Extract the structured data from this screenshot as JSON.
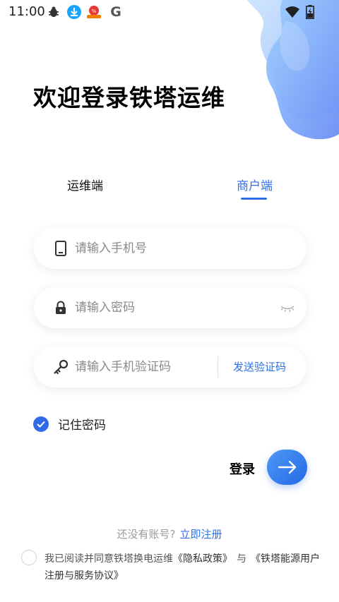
{
  "status_bar": {
    "time": "11:00",
    "icons": [
      "bug-icon",
      "download-icon",
      "notification-app-icon",
      "google-icon",
      "wifi-icon",
      "battery-charging-icon"
    ],
    "google_letter": "G"
  },
  "page_title": "欢迎登录铁塔运维",
  "tabs": [
    {
      "label": "运维端",
      "active": false
    },
    {
      "label": "商户端",
      "active": true
    }
  ],
  "form": {
    "phone_placeholder": "请输入手机号",
    "password_placeholder": "请输入密码",
    "code_placeholder": "请输入手机验证码",
    "send_code_label": "发送验证码"
  },
  "remember": {
    "label": "记住密码",
    "checked": true
  },
  "login": {
    "label": "登录"
  },
  "register": {
    "question": "还没有账号?",
    "link": "立即注册"
  },
  "agreement": {
    "prefix": "我已阅读并同意铁塔换电运维",
    "privacy_link": "《隐私政策》",
    "conjunction": "与",
    "terms_link": "《铁塔能源用户注册与服务协议》",
    "checked": false
  },
  "colors": {
    "accent": "#2d6fe8",
    "blob_light": "#a9cbff",
    "blob_dark": "#5f86f2"
  }
}
